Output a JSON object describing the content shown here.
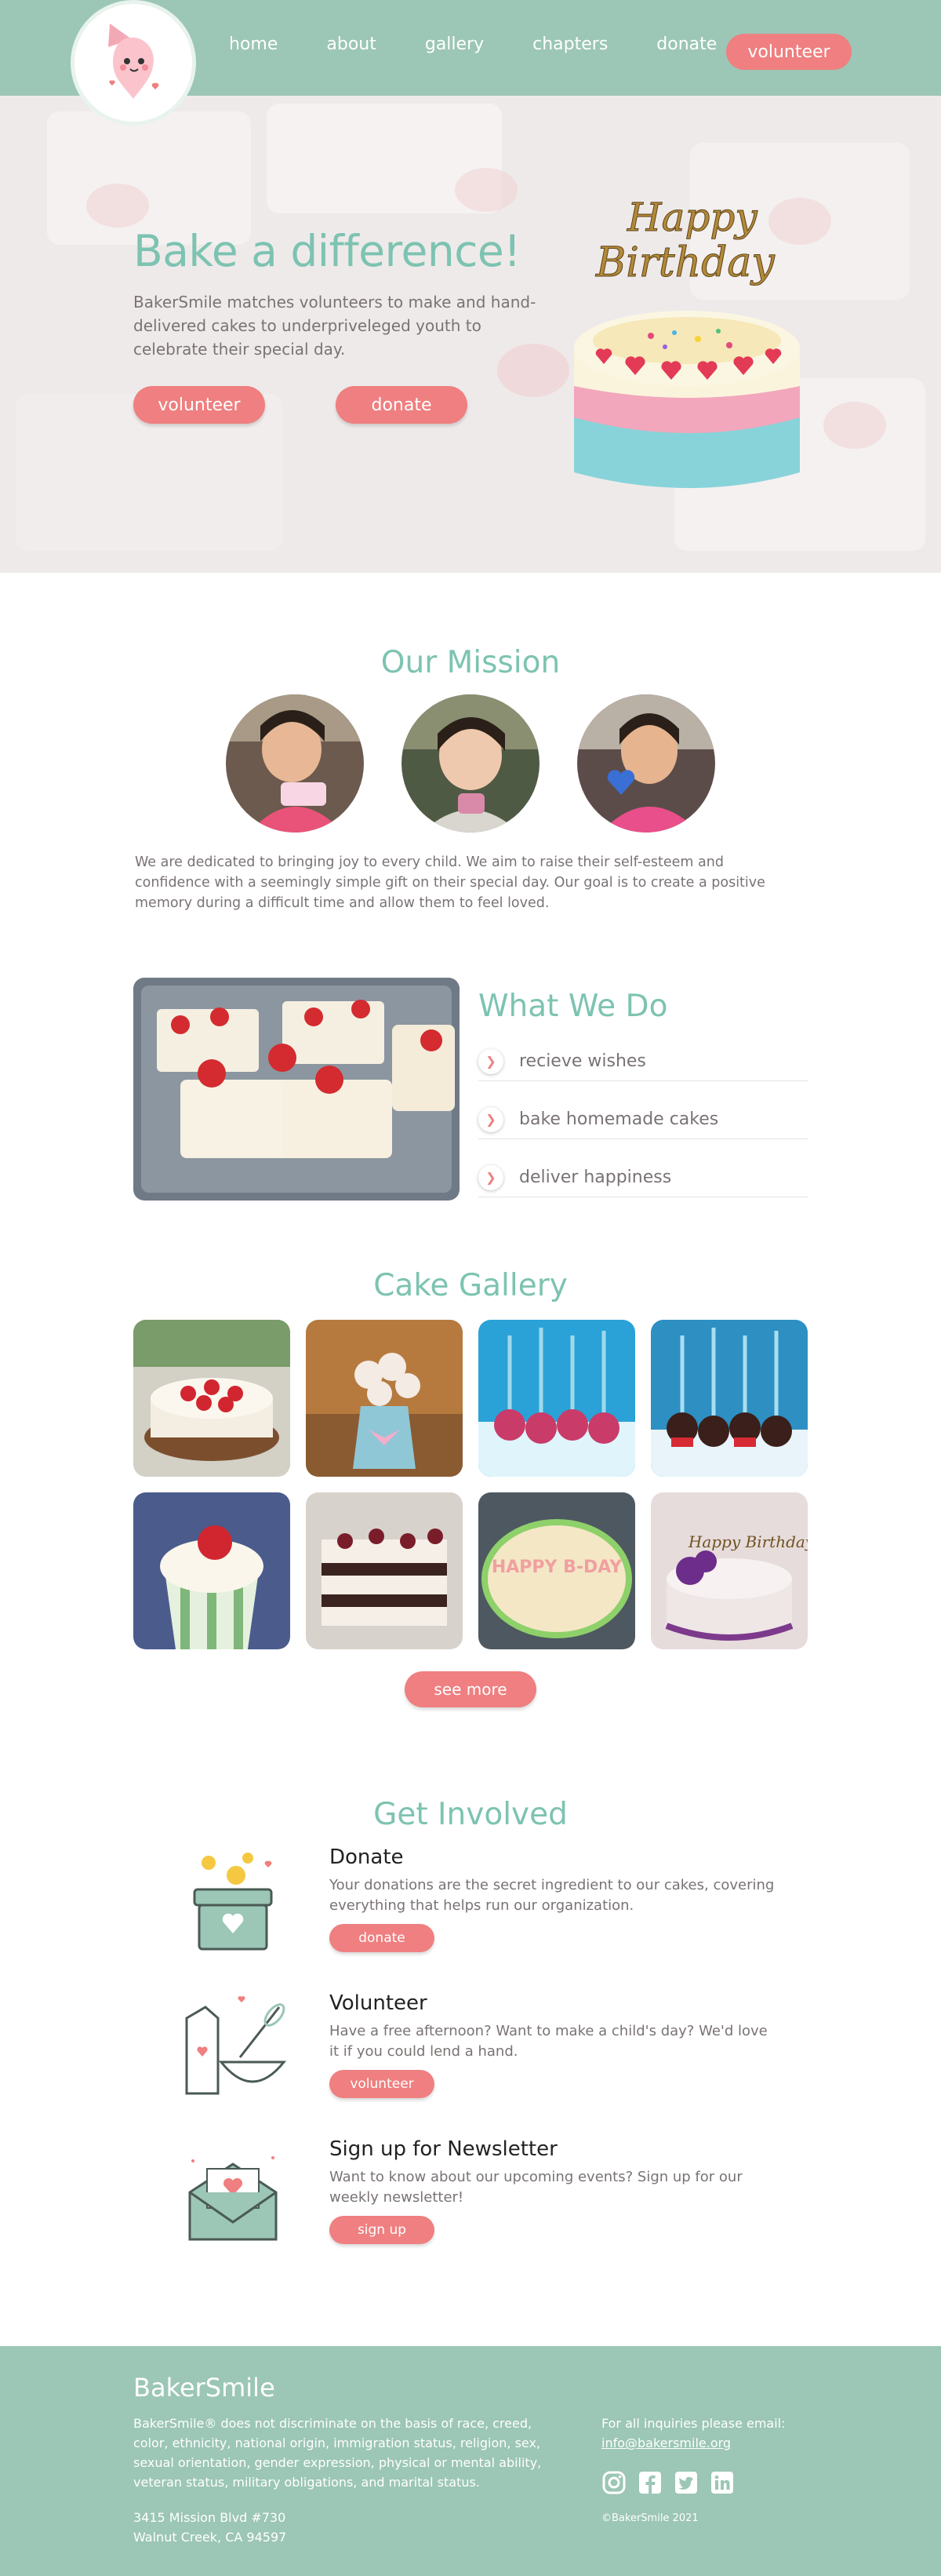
{
  "nav": {
    "links": [
      "home",
      "about",
      "gallery",
      "chapters",
      "donate"
    ],
    "cta": "volunteer",
    "logo_icon": "piping-bag-mascot-icon"
  },
  "hero": {
    "title": "Bake a difference!",
    "subtitle": "BakerSmile matches volunteers to make and hand-delivered cakes to underpriveleged youth to celebrate their special day.",
    "buttons": [
      "volunteer",
      "donate"
    ],
    "topper_text": [
      "Happy",
      "Birthday"
    ]
  },
  "mission": {
    "title": "Our Mission",
    "text": "We are dedicated to bringing joy to every child. We aim to raise their self-esteem and confidence with a seemingly simple gift on their special day. Our goal is to create a positive memory during a difficult time and allow them to feel loved."
  },
  "whatwedo": {
    "title": "What We Do",
    "items": [
      "recieve wishes",
      "bake homemade cakes",
      "deliver happiness"
    ]
  },
  "gallery": {
    "title": "Cake Gallery",
    "button": "see more",
    "tile_texts": [
      "HAPPY B-DAY",
      "Happy Birthday"
    ]
  },
  "involved": {
    "title": "Get Involved",
    "items": [
      {
        "title": "Donate",
        "desc": "Your donations are the secret ingredient to our cakes, covering everything that helps run our organization.",
        "button": "donate",
        "icon": "donation-box-icon"
      },
      {
        "title": "Volunteer",
        "desc": "Have a free afternoon? Want to make a child's day? We'd love it if you could lend a hand.",
        "button": "volunteer",
        "icon": "baking-whisk-icon"
      },
      {
        "title": "Sign up for Newsletter",
        "desc": "Want to know about our upcoming events? Sign up for our weekly newsletter!",
        "button": "sign up",
        "icon": "envelope-heart-icon"
      }
    ]
  },
  "footer": {
    "brand": "BakerSmile",
    "legal": "BakerSmile® does not discriminate on the basis of race, creed, color, ethnicity, national origin, immigration status, religion, sex, sexual orientation, gender expression, physical or mental ability, veteran status, military obligations, and marital status.",
    "address_line1": "3415 Mission Blvd #730",
    "address_line2": "Walnut Creek, CA 94597",
    "inquiries": "For all inquiries please email:",
    "email": "info@bakersmile.org",
    "copyright": "©BakerSmile 2021",
    "social_icons": [
      "instagram-icon",
      "facebook-icon",
      "twitter-icon",
      "linkedin-icon"
    ]
  },
  "colors": {
    "teal": "#9cc6b6",
    "teal_text": "#7dc3b1",
    "coral": "#ef7f80",
    "body_text": "#7a7373"
  }
}
